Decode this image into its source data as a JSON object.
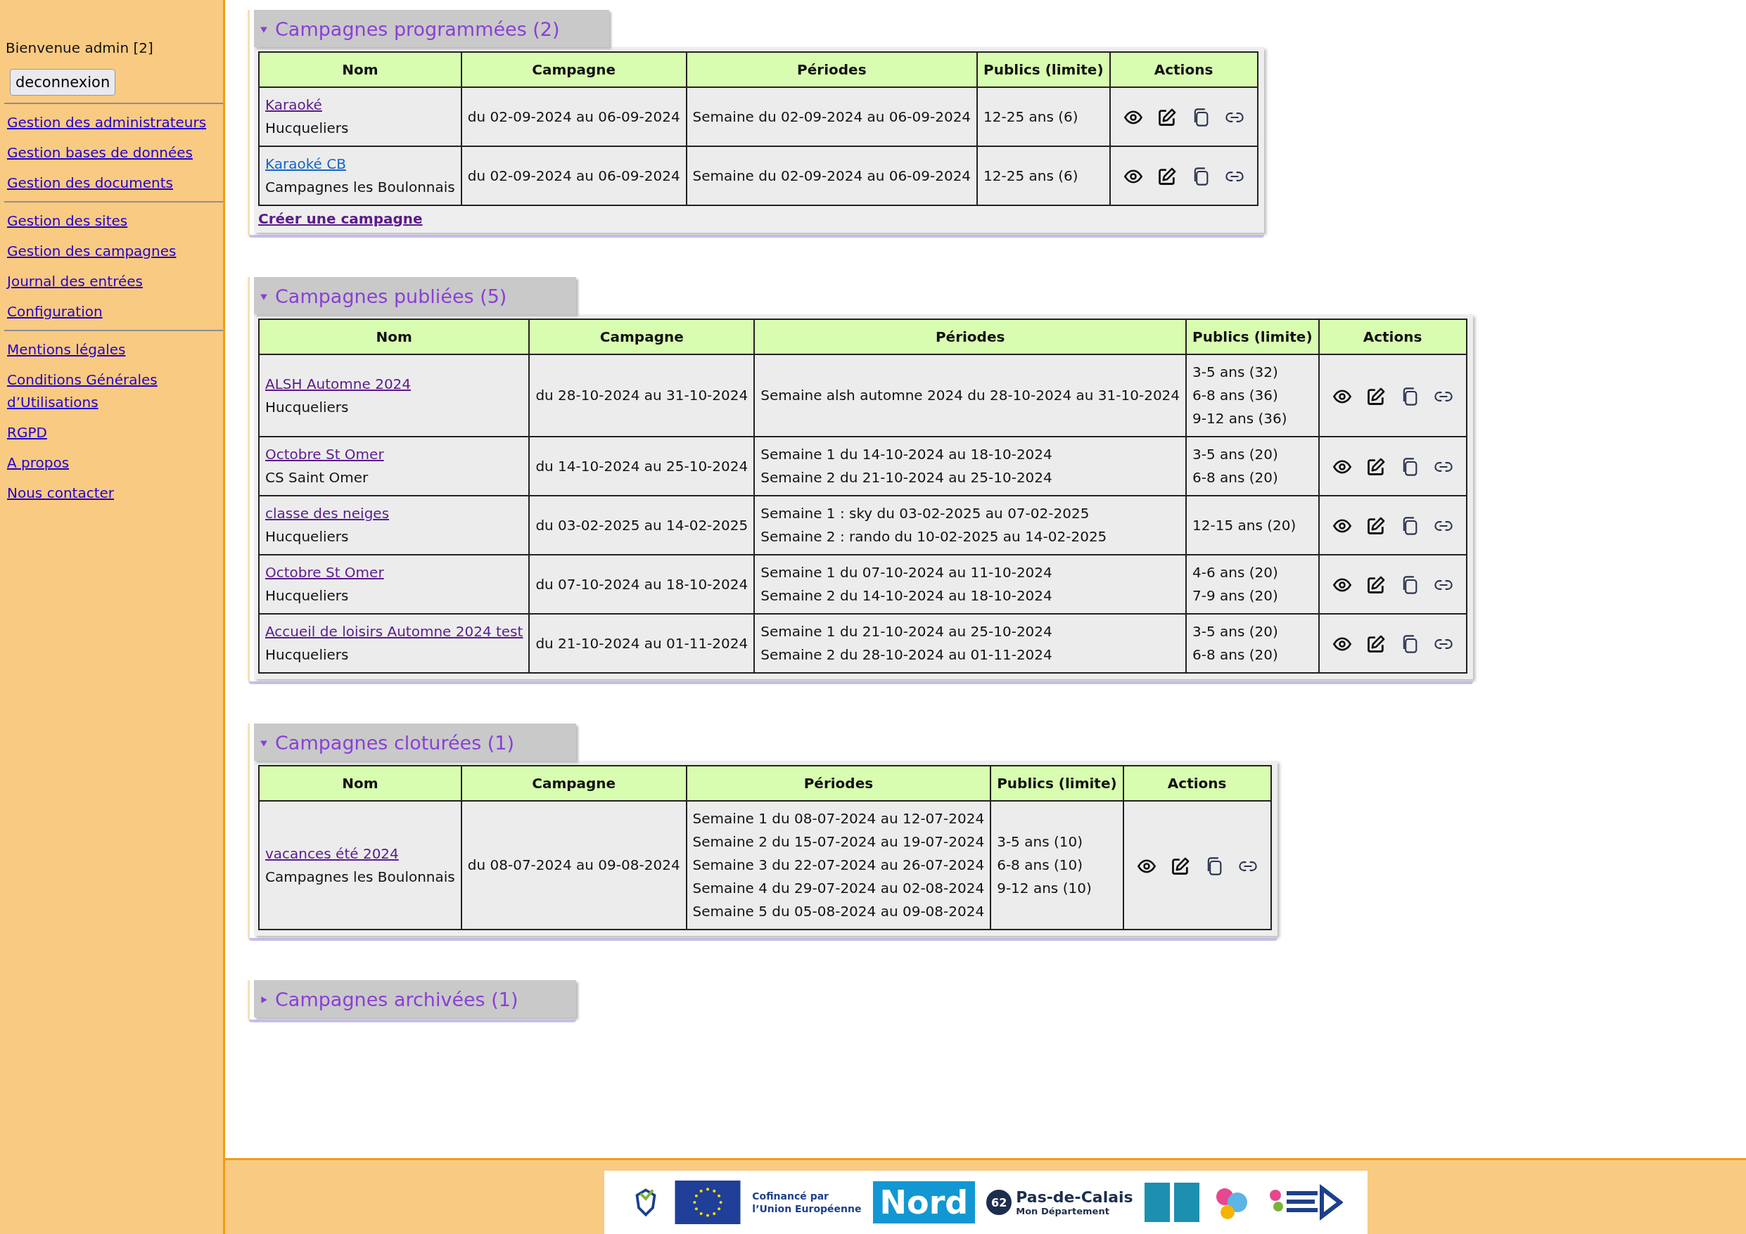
{
  "sidebar": {
    "welcome": "Bienvenue admin [2]",
    "logout_button": "deconnexion",
    "groups": [
      {
        "links": [
          "Gestion des administrateurs",
          "Gestion bases de données",
          "Gestion des documents"
        ]
      },
      {
        "links": [
          "Gestion des sites",
          "Gestion des campagnes",
          "Journal des entrées",
          "Configuration"
        ]
      },
      {
        "links": [
          "Mentions légales",
          "Conditions Générales d’Utilisations",
          "RGPD",
          "A propos",
          "Nous contacter"
        ]
      }
    ]
  },
  "sections": [
    {
      "title": "Campagnes programmées (2)",
      "expanded": true,
      "columns": [
        "Nom",
        "Campagne",
        "Périodes",
        "Publics (limite)",
        "Actions"
      ],
      "rows": [
        {
          "name": "Karaoké",
          "visited": true,
          "site": "Hucqueliers",
          "campaign": "du 02-09-2024 au 06-09-2024",
          "periods": [
            "Semaine du 02-09-2024 au 06-09-2024"
          ],
          "publics": [
            "12-25 ans (6)"
          ]
        },
        {
          "name": "Karaoké CB",
          "visited": false,
          "site": "Campagnes les Boulonnais",
          "campaign": "du 02-09-2024 au 06-09-2024",
          "periods": [
            "Semaine du 02-09-2024 au 06-09-2024"
          ],
          "publics": [
            "12-25 ans (6)"
          ]
        }
      ],
      "create_link": "Créer une campagne"
    },
    {
      "title": "Campagnes publiées (5)",
      "expanded": true,
      "columns": [
        "Nom",
        "Campagne",
        "Périodes",
        "Publics (limite)",
        "Actions"
      ],
      "rows": [
        {
          "name": "ALSH Automne 2024",
          "visited": true,
          "site": "Hucqueliers",
          "campaign": "du 28-10-2024 au 31-10-2024",
          "periods": [
            "Semaine alsh automne 2024 du 28-10-2024 au 31-10-2024"
          ],
          "publics": [
            "3-5 ans (32)",
            "6-8 ans (36)",
            "9-12 ans (36)"
          ]
        },
        {
          "name": "Octobre St Omer",
          "visited": true,
          "site": "CS Saint Omer",
          "campaign": "du 14-10-2024 au 25-10-2024",
          "periods": [
            "Semaine 1 du 14-10-2024 au 18-10-2024",
            "Semaine 2 du 21-10-2024 au 25-10-2024"
          ],
          "publics": [
            "3-5 ans (20)",
            "6-8 ans (20)"
          ]
        },
        {
          "name": "classe des neiges",
          "visited": true,
          "site": "Hucqueliers",
          "campaign": "du 03-02-2025 au 14-02-2025",
          "periods": [
            "Semaine 1 : sky du 03-02-2025 au 07-02-2025",
            "Semaine 2 : rando du 10-02-2025 au 14-02-2025"
          ],
          "publics": [
            "12-15 ans (20)"
          ]
        },
        {
          "name": "Octobre St Omer",
          "visited": true,
          "site": "Hucqueliers",
          "campaign": "du 07-10-2024 au 18-10-2024",
          "periods": [
            "Semaine 1 du 07-10-2024 au 11-10-2024",
            "Semaine 2 du 14-10-2024 au 18-10-2024"
          ],
          "publics": [
            "4-6 ans (20)",
            "7-9 ans (20)"
          ]
        },
        {
          "name": "Accueil de loisirs Automne 2024 test",
          "visited": true,
          "site": "Hucqueliers",
          "campaign": "du 21-10-2024 au 01-11-2024",
          "periods": [
            "Semaine 1 du 21-10-2024 au 25-10-2024",
            "Semaine 2 du 28-10-2024 au 01-11-2024"
          ],
          "publics": [
            "3-5 ans (20)",
            "6-8 ans (20)"
          ]
        }
      ]
    },
    {
      "title": "Campagnes cloturées (1)",
      "expanded": true,
      "columns": [
        "Nom",
        "Campagne",
        "Périodes",
        "Publics (limite)",
        "Actions"
      ],
      "rows": [
        {
          "name": "vacances été 2024",
          "visited": true,
          "site": "Campagnes les Boulonnais",
          "campaign": "du 08-07-2024 au 09-08-2024",
          "periods": [
            "Semaine 1 du 08-07-2024 au 12-07-2024",
            "Semaine 2 du 15-07-2024 au 19-07-2024",
            "Semaine 3 du 22-07-2024 au 26-07-2024",
            "Semaine 4 du 29-07-2024 au 02-08-2024",
            "Semaine 5 du 05-08-2024 au 09-08-2024"
          ],
          "publics": [
            "3-5 ans (10)",
            "6-8 ans (10)",
            "9-12 ans (10)"
          ]
        }
      ]
    },
    {
      "title": "Campagnes archivées (1)",
      "expanded": false
    }
  ],
  "footer": {
    "eu_text": [
      "Cofinancé par",
      "l’Union Européenne"
    ],
    "nord": "Nord",
    "pdc_number": "62",
    "pdc_name": "Pas-de-Calais",
    "pdc_tagline": "Mon Département"
  }
}
